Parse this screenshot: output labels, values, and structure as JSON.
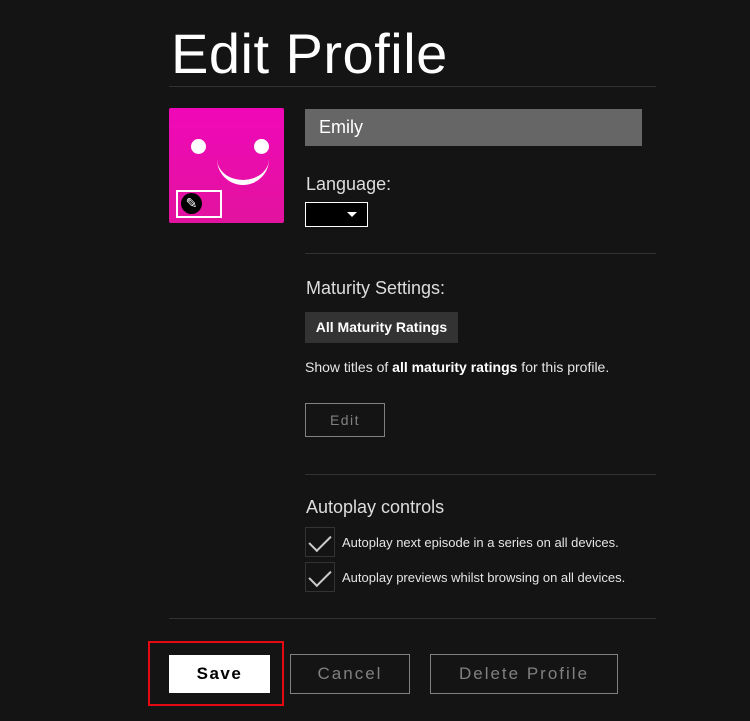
{
  "page": {
    "title": "Edit Profile"
  },
  "profile": {
    "avatar_icon": "smiley-avatar-icon",
    "avatar_color": "#f008b8",
    "edit_icon": "pencil-icon",
    "name_value": "Emily"
  },
  "language": {
    "label": "Language:",
    "selected": ""
  },
  "maturity": {
    "label": "Maturity Settings:",
    "badge": "All Maturity Ratings",
    "desc_prefix": "Show titles of ",
    "desc_bold": "all maturity ratings",
    "desc_suffix": " for this profile.",
    "edit_label": "Edit"
  },
  "autoplay": {
    "label": "Autoplay controls",
    "options": [
      {
        "label": "Autoplay next episode in a series on all devices.",
        "checked": true
      },
      {
        "label": "Autoplay previews whilst browsing on all devices.",
        "checked": true
      }
    ]
  },
  "actions": {
    "save_label": "Save",
    "cancel_label": "Cancel",
    "delete_label": "Delete Profile",
    "highlight_color": "#e50914"
  }
}
